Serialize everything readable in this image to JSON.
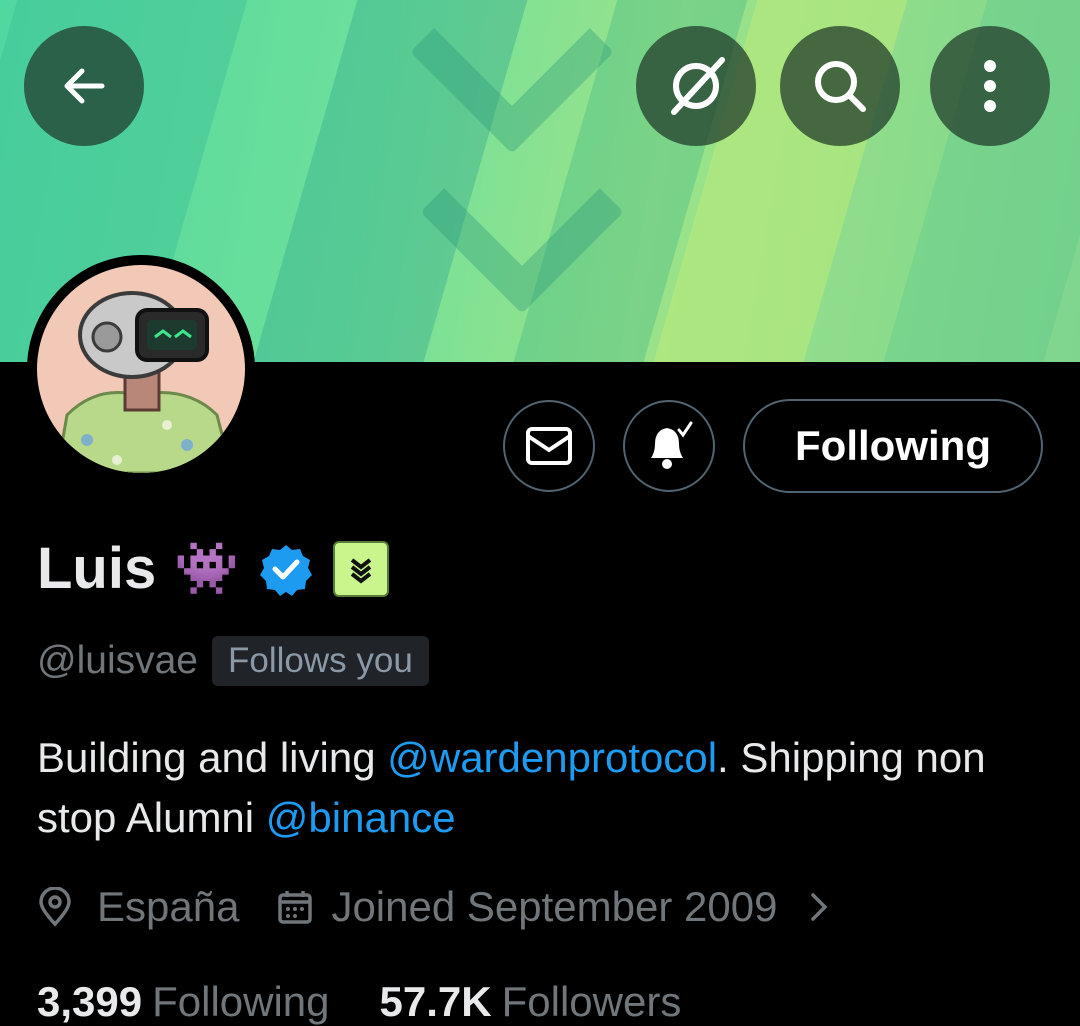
{
  "header": {
    "back_icon": "arrow-left-icon",
    "grok_icon": "slash-circle-icon",
    "search_icon": "search-icon",
    "more_icon": "more-vertical-icon"
  },
  "actions": {
    "message_icon": "envelope-icon",
    "notify_icon": "bell-check-icon",
    "following_label": "Following"
  },
  "profile": {
    "name": "Luis",
    "name_emoji": "👾",
    "verified_icon": "verified-badge-icon",
    "affiliate_icon": "affiliate-badge-icon",
    "handle": "@luisvae",
    "follows_you": "Follows you",
    "bio": {
      "part1": "Building and living ",
      "mention1": "@wardenprotocol",
      "part2": ". Shipping non stop  Alumni ",
      "mention2": "@binance"
    },
    "location": "España",
    "joined": "Joined September 2009"
  },
  "stats": {
    "following_count": "3,399",
    "following_label": "Following",
    "followers_count": "57.7K",
    "followers_label": "Followers"
  },
  "colors": {
    "accent": "#1d9bf0",
    "muted": "#71767b",
    "border": "#536471"
  }
}
